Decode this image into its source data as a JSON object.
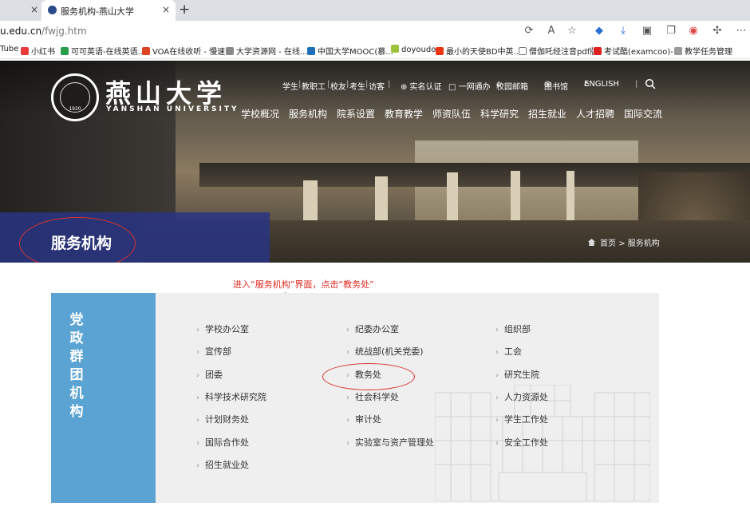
{
  "browser": {
    "tabs": [
      {
        "label": "",
        "close": "×"
      },
      {
        "label": "服务机构-燕山大学",
        "close": "×",
        "active": true
      }
    ],
    "new_tab": "+",
    "url_host": "u.edu.cn",
    "url_path": "/fwjg.htm",
    "bookmarks": [
      "Tube",
      "小红书",
      "可可英语-在线英语...",
      "VOA在线收听 - 慢速...",
      "大学资源网 - 在线...",
      "中国大学MOOC(慕...",
      "doyoudo",
      "最小的天使BD中英...",
      "僧伽吒经注音pdf版",
      "考试酷(examcoo)-...",
      "教学任务管理"
    ]
  },
  "header": {
    "logo_cn": "燕山大学",
    "logo_en": "YANSHAN UNIVERSITY",
    "seal_year": "1920",
    "toplinks": [
      "学生",
      "|",
      "教职工",
      "|",
      "校友",
      "|",
      "考生",
      "|",
      "访客",
      "|",
      "⊕ 实名认证",
      "□ 一网通办",
      "校园邮箱",
      "图书馆",
      "ENGLISH",
      "|"
    ],
    "nav": [
      "学校概况",
      "服务机构",
      "院系设置",
      "教育教学",
      "师资队伍",
      "科学研究",
      "招生就业",
      "人才招聘",
      "国际交流"
    ]
  },
  "banner": {
    "section_title": "服务机构",
    "breadcrumb_home": "首页",
    "breadcrumb_sep": ">",
    "breadcrumb_current": "服务机构"
  },
  "annotation": {
    "instruction": "进入“服务机构”界面，点击“教务处”"
  },
  "panel": {
    "title": "党政群团机构",
    "chevron": "›",
    "links": [
      "学校办公室",
      "纪委办公室",
      "组织部",
      "宣传部",
      "统战部(机关党委)",
      "工会",
      "团委",
      "教务处",
      "研究生院",
      "科学技术研究院",
      "社会科学处",
      "人力资源处",
      "计划财务处",
      "审计处",
      "学生工作处",
      "国际合作处",
      "实验室与资产管理处",
      "安全工作处",
      "招生就业处"
    ]
  },
  "colors": {
    "accent_blue": "#5aa3d3",
    "band_navy": "#283482",
    "annotation_red": "#e0261e"
  }
}
